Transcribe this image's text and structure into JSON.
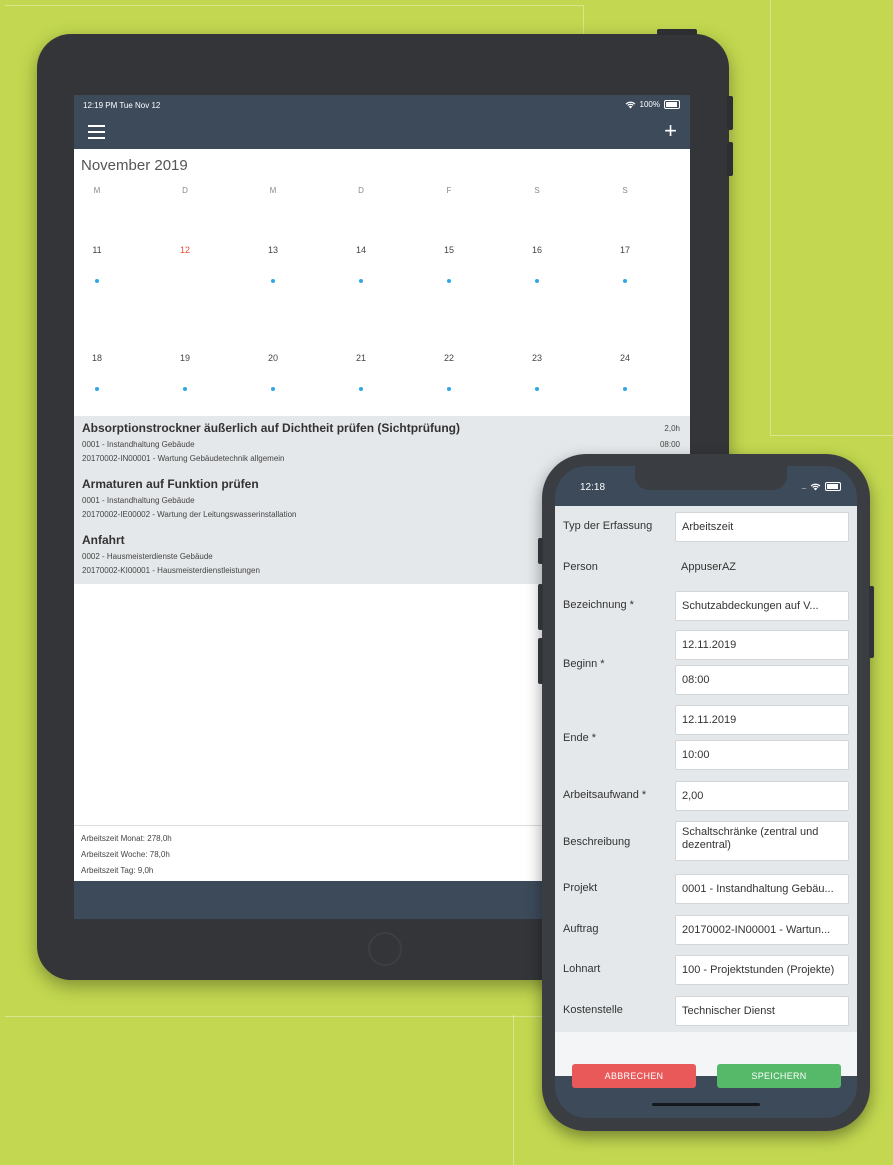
{
  "tablet": {
    "status": {
      "time_date": "12:19 PM  Tue Nov 12",
      "battery": "100%"
    },
    "month_title": "November 2019",
    "weekdays": [
      "M",
      "D",
      "M",
      "D",
      "F",
      "S",
      "S"
    ],
    "weeks": [
      {
        "days": [
          "11",
          "12",
          "13",
          "14",
          "15",
          "16",
          "17"
        ],
        "today_index": 1,
        "dots": [
          true,
          false,
          true,
          true,
          true,
          true,
          true
        ]
      },
      {
        "days": [
          "18",
          "19",
          "20",
          "21",
          "22",
          "23",
          "24"
        ],
        "today_index": -1,
        "dots": [
          true,
          true,
          true,
          true,
          true,
          true,
          true
        ]
      }
    ],
    "events": [
      {
        "title": "Absorptionstrockner äußerlich auf Dichtheit prüfen (Sichtprüfung)",
        "line1": "0001 - Instandhaltung Gebäude",
        "line2": "20170002-IN00001 - Wartung Gebäudetechnik allgemein",
        "duration": "2,0h",
        "time": "08:00"
      },
      {
        "title": "Armaturen auf Funktion prüfen",
        "line1": "0001 - Instandhaltung Gebäude",
        "line2": "20170002-IE00002 - Wartung der Leitungswasserinstallation",
        "duration": "",
        "time": ""
      },
      {
        "title": "Anfahrt",
        "line1": "0002 - Hausmeisterdienste Gebäude",
        "line2": "20170002-KI00001 - Hausmeisterdienstleistungen",
        "duration": "",
        "time": ""
      }
    ],
    "stats": {
      "month": "Arbeitszeit Monat: 278,0h",
      "week": "Arbeitszeit Woche: 78,0h",
      "day": "Arbeitszeit Tag: 9,0h"
    }
  },
  "phone": {
    "status": {
      "time": "12:18"
    },
    "form": {
      "typ": {
        "label": "Typ der Erfassung",
        "value": "Arbeitszeit"
      },
      "person": {
        "label": "Person",
        "value": "AppuserAZ"
      },
      "bezeichnung": {
        "label": "Bezeichnung *",
        "value": "Schutzabdeckungen auf V..."
      },
      "beginn": {
        "label": "Beginn *",
        "date": "12.11.2019",
        "time": "08:00"
      },
      "ende": {
        "label": "Ende *",
        "date": "12.11.2019",
        "time": "10:00"
      },
      "arbeitsaufwand": {
        "label": "Arbeitsaufwand *",
        "value": "2,00"
      },
      "beschreibung": {
        "label": "Beschreibung",
        "value": "Schaltschränke (zentral und dezentral)"
      },
      "projekt": {
        "label": "Projekt",
        "value": "0001 - Instandhaltung Gebäu..."
      },
      "auftrag": {
        "label": "Auftrag",
        "value": "20170002-IN00001 - Wartun..."
      },
      "lohnart": {
        "label": "Lohnart",
        "value": "100 - Projektstunden (Projekte)"
      },
      "kostenstelle": {
        "label": "Kostenstelle",
        "value": "Technischer Dienst"
      }
    },
    "buttons": {
      "cancel": "ABBRECHEN",
      "save": "SPEICHERN"
    }
  },
  "colors": {
    "background": "#c3d850",
    "header": "#3d4a5a",
    "today": "#e74c3c",
    "event_dot": "#2fa9e6",
    "cancel": "#e9595a",
    "save": "#56b96a"
  }
}
